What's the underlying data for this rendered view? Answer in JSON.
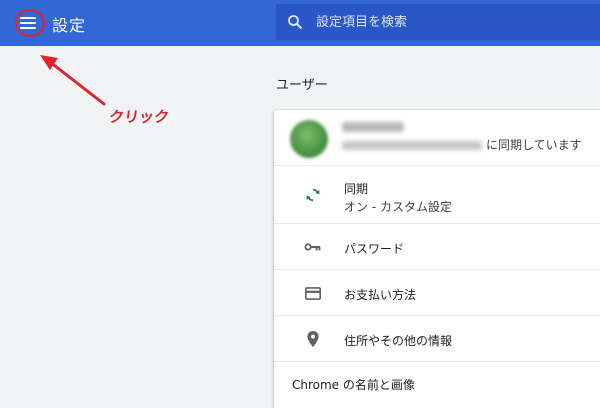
{
  "header": {
    "title": "設定",
    "menu_icon": "hamburger-menu-icon",
    "search": {
      "placeholder": "設定項目を検索",
      "icon": "search-icon"
    }
  },
  "annotation": {
    "label": "クリック",
    "color": "#d8232a"
  },
  "section": {
    "title": "ユーザー"
  },
  "account": {
    "sync_text": "に同期しています"
  },
  "items": [
    {
      "label": "同期",
      "sub": "オン - カスタム設定",
      "icon": "sync-icon"
    },
    {
      "label": "パスワード",
      "icon": "key-icon"
    },
    {
      "label": "お支払い方法",
      "icon": "credit-card-icon"
    },
    {
      "label": "住所やその他の情報",
      "icon": "location-pin-icon"
    },
    {
      "label": "Chrome の名前と画像"
    }
  ],
  "colors": {
    "header_bg": "#3367d6",
    "search_bg": "#2a56c6",
    "page_bg": "#f1f3f4",
    "sync_green": "#188038"
  }
}
